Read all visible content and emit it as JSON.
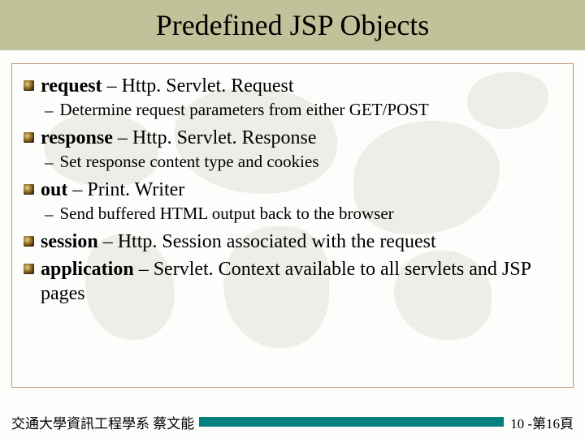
{
  "title": "Predefined JSP Objects",
  "items": [
    {
      "bold": "request",
      "rest": " – Http. Servlet. Request",
      "sub": "Determine request parameters from either GET/POST"
    },
    {
      "bold": "response",
      "rest": " – Http. Servlet. Response",
      "sub": "Set response content type and cookies"
    },
    {
      "bold": "out",
      "rest": " – Print. Writer",
      "sub": "Send buffered HTML output back to the browser"
    },
    {
      "bold": "session",
      "rest": " – Http. Session associated with the request",
      "sub": null
    },
    {
      "bold": "application",
      "rest": " – Servlet. Context available to all servlets and JSP pages",
      "sub": null
    }
  ],
  "footer": {
    "left": "交通大學資訊工程學系 蔡文能",
    "right": "10 -第16頁"
  }
}
